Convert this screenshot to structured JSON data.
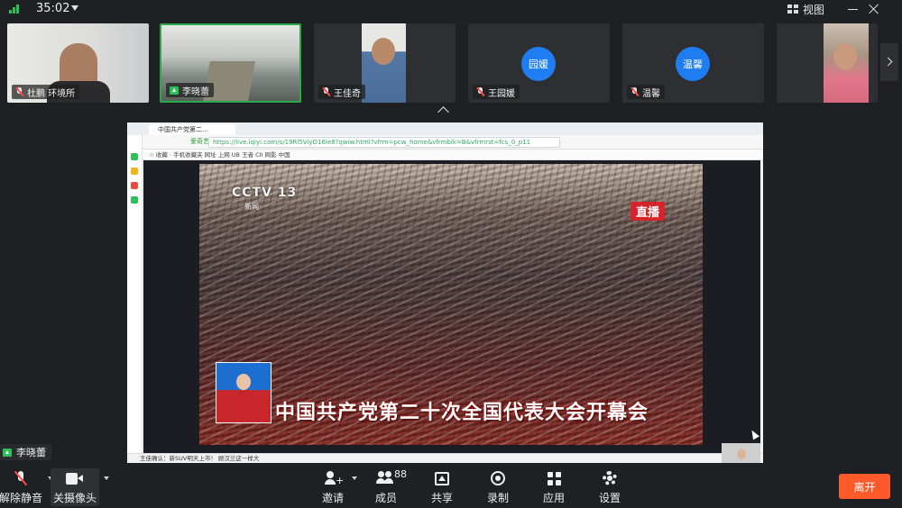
{
  "topbar": {
    "timer": "35:02",
    "view_label": "视图"
  },
  "participants": [
    {
      "name": "杜鹏 环境所",
      "type": "video",
      "muted": true,
      "bg": "#d8d8d4"
    },
    {
      "name": "李晓蕾",
      "type": "video",
      "muted": false,
      "sharing": true,
      "active": true,
      "bg": "#9aa39a"
    },
    {
      "name": "王佳奇",
      "type": "video",
      "muted": true,
      "bg": "#5d7fa8"
    },
    {
      "name": "王园媛",
      "type": "avatar",
      "avatar_text": "园媛",
      "muted": true
    },
    {
      "name": "温馨",
      "type": "avatar",
      "avatar_text": "温馨",
      "muted": true
    },
    {
      "name": "",
      "type": "video",
      "muted": false,
      "bg": "#c9b7a6"
    }
  ],
  "shared_screen": {
    "browser_tab_title": "中国共产党第二...",
    "address_site": "爱奇艺",
    "address_url": "https://live.iqiyi.com/s/19Rl5ViyO16le8?qwiw.html?vfrm=pcw_home&vfrmblk=B&vfrmrst=fcs_0_p11",
    "favorites": "☆ 收藏 · 手机收藏夹  网址  上网  UB  王者  CII  网影  中国",
    "channel_logo": "CCTV 13",
    "channel_sub": "新闻",
    "live_badge": "直播",
    "caption": "中国共产党第二十次全国代表大会开幕会",
    "status_text": "王佳确认：新SUV明天上市！ 顾汉兰这一样大"
  },
  "speaker_tag": "李晓蕾",
  "toolbar": {
    "unmute_label": "解除静音",
    "camera_label": "关摄像头",
    "invite_label": "邀请",
    "members_label": "成员",
    "members_count": "88",
    "share_label": "共享",
    "record_label": "录制",
    "apps_label": "应用",
    "settings_label": "设置",
    "leave_label": "离开"
  },
  "colors": {
    "background": "#1f2023",
    "tile": "#2e2f33",
    "accent_green": "#29a94b",
    "avatar_blue": "#1e7df0",
    "leave_orange": "#ff5a2b",
    "muted_red": "#ff4b4b"
  }
}
